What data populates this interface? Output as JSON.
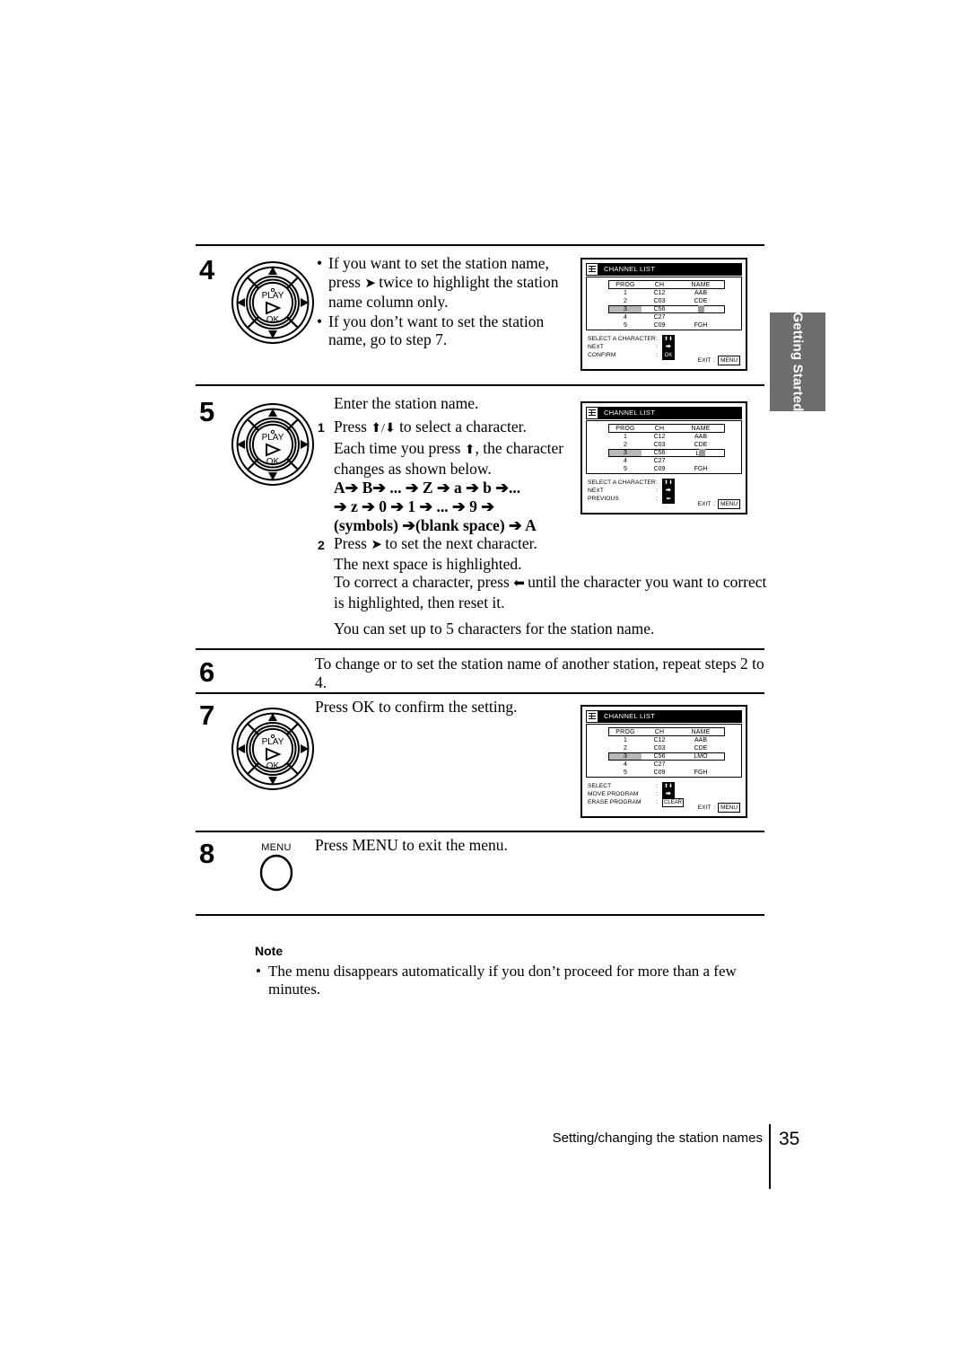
{
  "side_tab": {
    "label": "Getting Started"
  },
  "steps": [
    {
      "number": "4",
      "bullets": [
        "If you want to set the station name,",
        "press  ➜ twice to highlight the station",
        "name column only.",
        "If you don’t want to set the station",
        "name, go to step 7."
      ],
      "line1": "If you want to set the station name,",
      "line2a": "press",
      "line2b": "twice to highlight the station",
      "line3": "name column only.",
      "line4": "If you don’t want to set the station",
      "line5": "name, go to step 7."
    },
    {
      "number": "5",
      "intro": "Enter the station name.",
      "sub1_num": "1",
      "sub1_a": "Press",
      "sub1_b": "to select a  character.",
      "sub1_c": "Each time you press",
      "sub1_d": ", the character",
      "sub1_e": "changes as shown below.",
      "charseq_1": "A➔ B➔ ... ➔ Z ➔ a  ➔ b  ➔...",
      "charseq_2": "➔ z ➔ 0 ➔ 1 ➔ ... ➔ 9 ➔",
      "charseq_3": "(symbols) ➔(blank space)  ➔ A",
      "sub2_num": "2",
      "sub2_a": "Press",
      "sub2_b": "to set the next character.",
      "sub2_c": "The next space is highlighted.",
      "sub2_d": "To correct a character, press",
      "sub2_e": "until the character you want to correct",
      "sub2_f": "is highlighted, then reset it.",
      "closing": "You can set up to 5 characters for the station name."
    },
    {
      "number": "6",
      "text": "To change or to set the station name of another station, repeat steps 2 to 4."
    },
    {
      "number": "7",
      "text": "Press OK to confirm the setting."
    },
    {
      "number": "8",
      "text": "Press MENU to exit the menu.",
      "button_label": "MENU"
    }
  ],
  "joypad": {
    "play_label": "PLAY",
    "ok_label": "OK"
  },
  "osd_screens": [
    {
      "id": "screen-step4",
      "title": "CHANNEL LIST",
      "columns": [
        "PROG",
        "CH",
        "NAME"
      ],
      "rows": [
        {
          "prog": "1",
          "ch": "C12",
          "name": "AAB",
          "selected": false,
          "cursor": false
        },
        {
          "prog": "2",
          "ch": "C03",
          "name": "CDE",
          "selected": false,
          "cursor": false
        },
        {
          "prog": "3",
          "ch": "C56",
          "name": "",
          "selected": true,
          "cursor": true
        },
        {
          "prog": "4",
          "ch": "C27",
          "name": "",
          "selected": false,
          "cursor": false
        },
        {
          "prog": "5",
          "ch": "C09",
          "name": "FGH",
          "selected": false,
          "cursor": false
        }
      ],
      "legend": [
        {
          "label": "SELECT A CHARACTER",
          "key": "⬆⬇",
          "boxed": true
        },
        {
          "label": "NEXT",
          "key": "⮕",
          "boxed": true
        },
        {
          "label": "CONFIRM",
          "key": "OK",
          "boxed": true
        }
      ],
      "exit_label": "EXIT",
      "exit_key": "MENU"
    },
    {
      "id": "screen-step5",
      "title": "CHANNEL LIST",
      "columns": [
        "PROG",
        "CH",
        "NAME"
      ],
      "rows": [
        {
          "prog": "1",
          "ch": "C12",
          "name": "AAB",
          "selected": false,
          "cursor": false
        },
        {
          "prog": "2",
          "ch": "C03",
          "name": "CDE",
          "selected": false,
          "cursor": false
        },
        {
          "prog": "3",
          "ch": "C56",
          "name": "L",
          "selected": true,
          "cursor": true
        },
        {
          "prog": "4",
          "ch": "C27",
          "name": "",
          "selected": false,
          "cursor": false
        },
        {
          "prog": "5",
          "ch": "C09",
          "name": "FGH",
          "selected": false,
          "cursor": false
        }
      ],
      "legend": [
        {
          "label": "SELECT A CHARACTER",
          "key": "⬆⬇",
          "boxed": true
        },
        {
          "label": "NEXT",
          "key": "⮕",
          "boxed": true
        },
        {
          "label": "PREVIOUS",
          "key": "⬅",
          "boxed": true
        }
      ],
      "exit_label": "EXIT",
      "exit_key": "MENU"
    },
    {
      "id": "screen-step7",
      "title": "CHANNEL LIST",
      "columns": [
        "PROG",
        "CH",
        "NAME"
      ],
      "rows": [
        {
          "prog": "1",
          "ch": "C12",
          "name": "AAB",
          "selected": false,
          "cursor": false
        },
        {
          "prog": "2",
          "ch": "C03",
          "name": "CDE",
          "selected": false,
          "cursor": false
        },
        {
          "prog": "3",
          "ch": "C56",
          "name": "LMO",
          "selected": true,
          "cursor": false
        },
        {
          "prog": "4",
          "ch": "C27",
          "name": "",
          "selected": false,
          "cursor": false
        },
        {
          "prog": "5",
          "ch": "C09",
          "name": "FGH",
          "selected": false,
          "cursor": false
        }
      ],
      "legend": [
        {
          "label": "SELECT",
          "key": "⬆⬇",
          "boxed": true
        },
        {
          "label": "MOVE PROGRAM",
          "key": "⮕",
          "boxed": true
        },
        {
          "label": "ERASE PROGRAM",
          "key": "CLEAR",
          "boxed": true,
          "plain": true
        }
      ],
      "exit_label": "EXIT",
      "exit_key": "MENU"
    }
  ],
  "note": {
    "title": "Note",
    "text": "The menu disappears automatically if you don’t proceed for more than a few minutes."
  },
  "footer": {
    "section": "Setting/changing the station names",
    "page": "35"
  }
}
